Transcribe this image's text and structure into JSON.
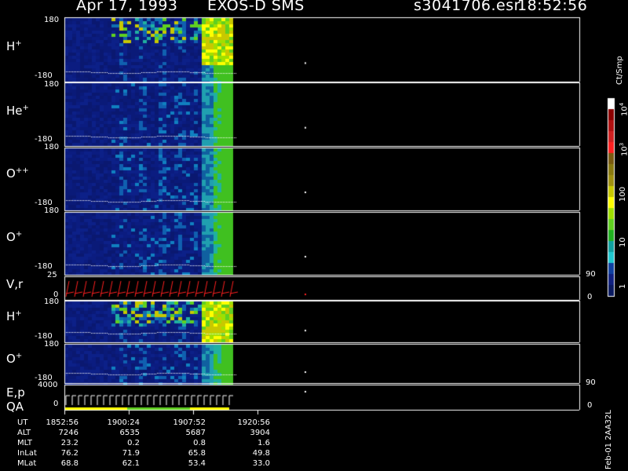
{
  "header": {
    "date": "Apr 17, 1993",
    "instrument": "EXOS-D SMS",
    "file": "s3041706.esr",
    "time": "18:52:56"
  },
  "chart_data": {
    "type": "heatmap",
    "panels": [
      {
        "label": "H",
        "sup": "+",
        "top_tick": "180",
        "bottom_tick": "-180"
      },
      {
        "label": "He",
        "sup": "+",
        "top_tick": "180",
        "bottom_tick": "-180"
      },
      {
        "label": "O",
        "sup": "++",
        "top_tick": "180",
        "bottom_tick": "-180"
      },
      {
        "label": "O",
        "sup": "+",
        "top_tick": "180",
        "bottom_tick": "-180"
      },
      {
        "label": "V,r",
        "sup": "",
        "top_tick": "25",
        "bottom_tick": "0",
        "right_top": "90",
        "right_bottom": "0"
      },
      {
        "label": "H",
        "sup": "+",
        "top_tick": "180",
        "bottom_tick": "-180"
      },
      {
        "label": "O",
        "sup": "+",
        "top_tick": "180",
        "bottom_tick": "-180"
      },
      {
        "label": "E,p",
        "label2": "QA",
        "sup": "",
        "top_tick": "4000",
        "bottom_tick": "0",
        "right_top": "90",
        "right_bottom": "0"
      }
    ],
    "colorbar": {
      "title": "Ct/Smp",
      "ticks": [
        "10",
        "3",
        "100",
        "10",
        "1",
        "10",
        "4"
      ],
      "tick_labels": [
        {
          "base": "10",
          "exp": "4"
        },
        {
          "base": "10",
          "exp": "3"
        },
        {
          "base": "100",
          "exp": ""
        },
        {
          "base": "10",
          "exp": ""
        },
        {
          "base": "1",
          "exp": ""
        }
      ],
      "colors": [
        "#ffffff",
        "#8b0000",
        "#b01010",
        "#d02020",
        "#ff2020",
        "#7a5a10",
        "#8a7a10",
        "#a09010",
        "#c8c800",
        "#ffff00",
        "#a0e000",
        "#60d020",
        "#20b020",
        "#10a0a0",
        "#20c8d0",
        "#1040a0",
        "#102080",
        "#0a1a60"
      ]
    },
    "ephemeris": {
      "rows": [
        "UT",
        "ALT",
        "MLT",
        "InLat",
        "MLat"
      ],
      "columns": [
        {
          "UT": "1852:56",
          "ALT": "7246",
          "MLT": "23.2",
          "InLat": "76.2",
          "MLat": "68.8"
        },
        {
          "UT": "1900:24",
          "ALT": "6535",
          "MLT": "0.2",
          "InLat": "71.9",
          "MLat": "62.1"
        },
        {
          "UT": "1907:52",
          "ALT": "5687",
          "MLT": "0.8",
          "InLat": "65.8",
          "MLat": "53.4"
        },
        {
          "UT": "1920:56",
          "ALT": "3904",
          "MLT": "1.6",
          "InLat": "49.8",
          "MLat": "33.0"
        }
      ]
    }
  },
  "footer_vertical": "Feb-01  2AA32L"
}
